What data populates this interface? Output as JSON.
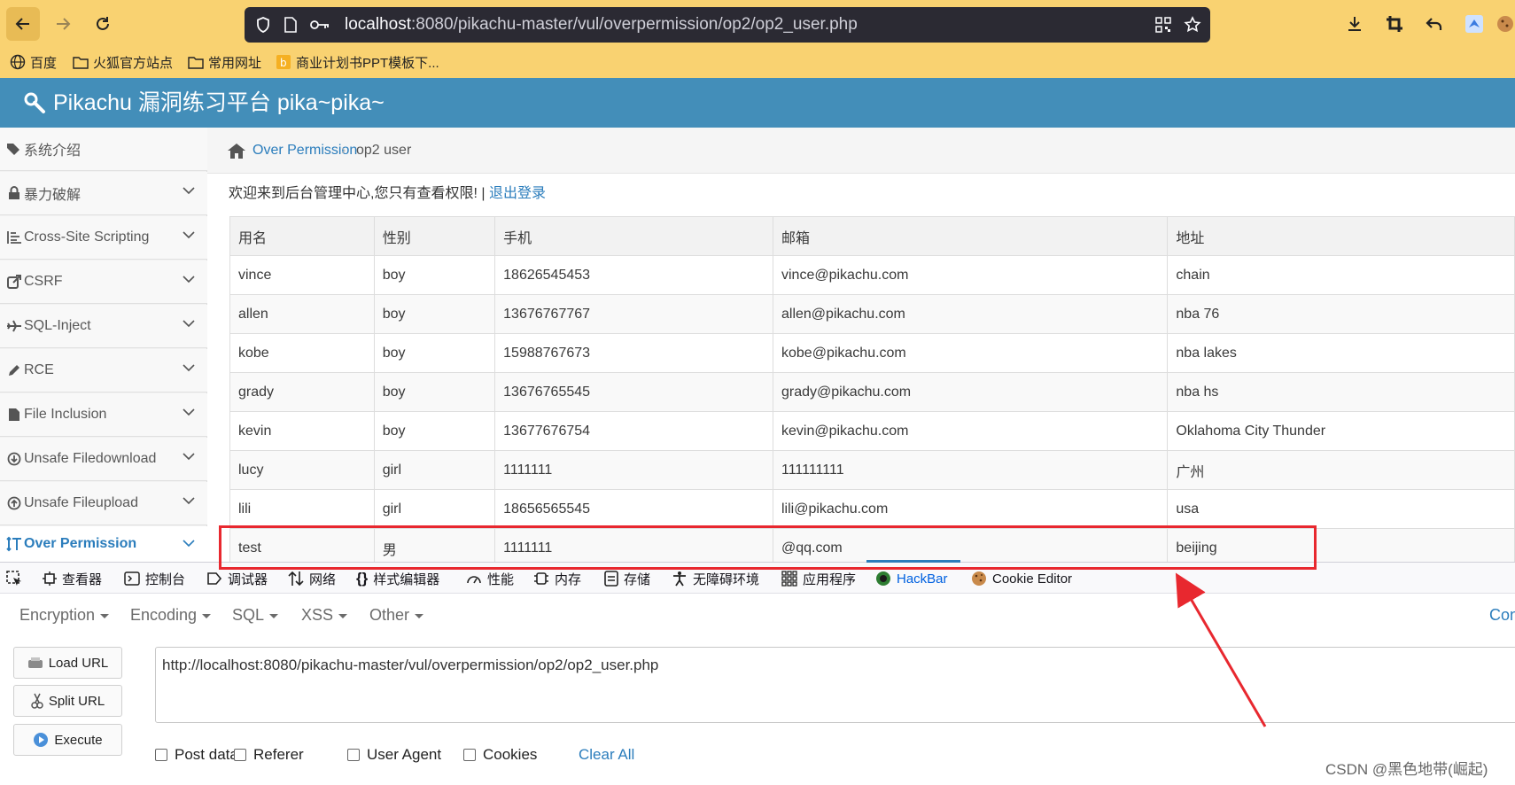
{
  "browser": {
    "url_host": "localhost",
    "url_rest": ":8080/pikachu-master/vul/overpermission/op2/op2_user.php"
  },
  "bookmarks": [
    {
      "label": "百度"
    },
    {
      "label": "火狐官方站点"
    },
    {
      "label": "常用网址"
    },
    {
      "label": "商业计划书PPT模板下..."
    }
  ],
  "site": {
    "title": "Pikachu 漏洞练习平台 pika~pika~"
  },
  "sidebar": {
    "items": [
      {
        "label": "系统介绍",
        "icon": "tags-icon"
      },
      {
        "label": "暴力破解",
        "icon": "lock-icon"
      },
      {
        "label": "Cross-Site Scripting",
        "icon": "list-icon"
      },
      {
        "label": "CSRF",
        "icon": "share-icon"
      },
      {
        "label": "SQL-Inject",
        "icon": "plane-icon"
      },
      {
        "label": "RCE",
        "icon": "pencil-icon"
      },
      {
        "label": "File Inclusion",
        "icon": "file-icon"
      },
      {
        "label": "Unsafe Filedownload",
        "icon": "download-circle-icon"
      },
      {
        "label": "Unsafe Fileupload",
        "icon": "upload-circle-icon"
      },
      {
        "label": "Over Permission",
        "icon": "text-height-icon"
      }
    ]
  },
  "breadcrumb": {
    "parent": "Over Permission",
    "separator": "›",
    "current": "op2 user"
  },
  "welcome": {
    "text": "欢迎来到后台管理中心,您只有查看权限! |",
    "logout": "退出登录"
  },
  "table": {
    "headers": [
      "用名",
      "性别",
      "手机",
      "邮箱",
      "地址"
    ],
    "rows": [
      [
        "vince",
        "boy",
        "18626545453",
        "vince@pikachu.com",
        "chain"
      ],
      [
        "allen",
        "boy",
        "13676767767",
        "allen@pikachu.com",
        "nba 76"
      ],
      [
        "kobe",
        "boy",
        "15988767673",
        "kobe@pikachu.com",
        "nba lakes"
      ],
      [
        "grady",
        "boy",
        "13676765545",
        "grady@pikachu.com",
        "nba hs"
      ],
      [
        "kevin",
        "boy",
        "13677676754",
        "kevin@pikachu.com",
        "Oklahoma City Thunder"
      ],
      [
        "lucy",
        "girl",
        "1111111",
        "111111111",
        "广州"
      ],
      [
        "lili",
        "girl",
        "18656565545",
        "lili@pikachu.com",
        "usa"
      ],
      [
        "test",
        "男",
        "1111111",
        "@qq.com",
        "beijing"
      ]
    ]
  },
  "devtools": {
    "tabs": [
      "查看器",
      "控制台",
      "调试器",
      "网络",
      "样式编辑器",
      "性能",
      "内存",
      "存储",
      "无障碍环境",
      "应用程序",
      "HackBar",
      "Cookie Editor"
    ],
    "selected": "HackBar"
  },
  "hackbar": {
    "menus": [
      "Encryption",
      "Encoding",
      "SQL",
      "XSS",
      "Other"
    ],
    "con_label": "Con",
    "buttons": [
      "Load URL",
      "Split URL",
      "Execute"
    ],
    "url_value": "http://localhost:8080/pikachu-master/vul/overpermission/op2/op2_user.php",
    "checkboxes": [
      "Post data",
      "Referer",
      "User Agent",
      "Cookies"
    ],
    "clear_all": "Clear All"
  },
  "watermark": "CSDN @黑色地带(崛起)",
  "colors": {
    "toolbar": "#f9d271",
    "header": "#438eb9",
    "link": "#2b7dbc",
    "highlight_box": "#e8282f"
  }
}
